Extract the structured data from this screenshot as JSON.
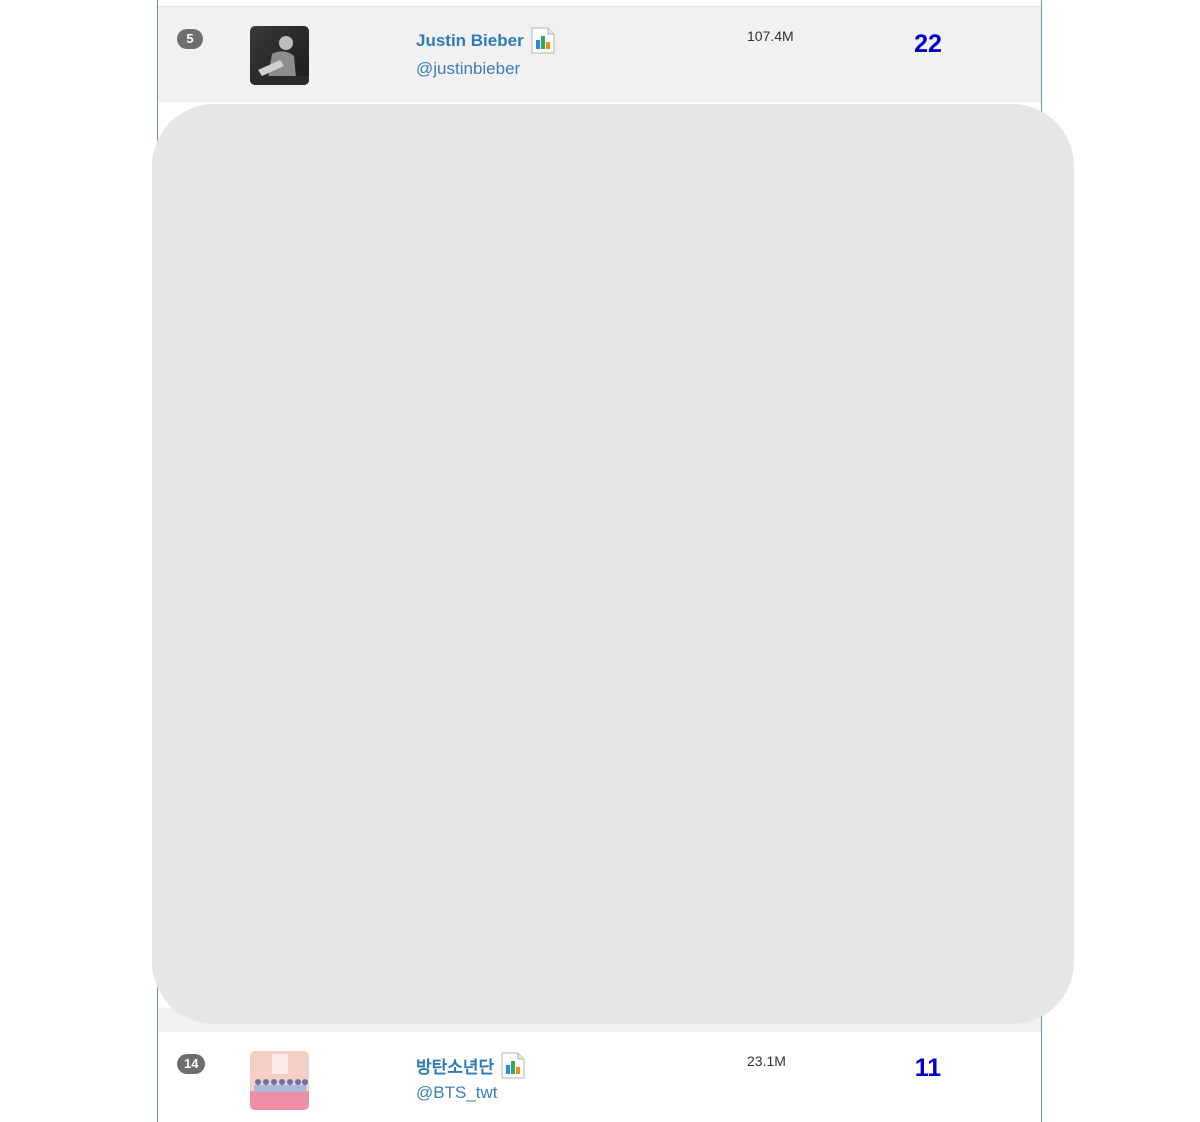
{
  "rows": [
    {
      "rank": "5",
      "name": "Justin Bieber",
      "handle": "@justinbieber",
      "followers": "107.4M",
      "score": "22"
    },
    {
      "rank": "14",
      "name": "방탄소년단",
      "handle": "@BTS_twt",
      "followers": "23.1M",
      "score": "11"
    }
  ],
  "icons": {
    "stats": "bar-chart-icon"
  },
  "colors": {
    "link": "#2f7ab8",
    "score": "#0000c4",
    "rank_badge": "#6e6e6e",
    "placeholder": "#e5e6e8",
    "frame_border": "#6c8fb8"
  }
}
